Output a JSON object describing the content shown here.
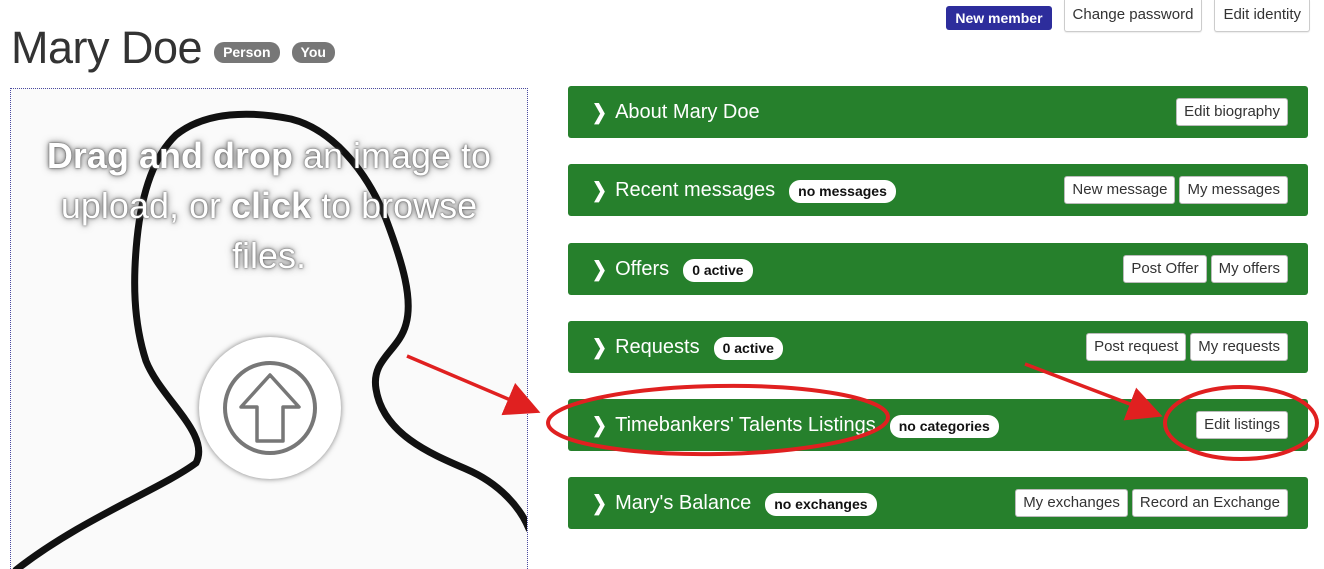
{
  "header": {
    "title": "Mary Doe",
    "badges": [
      "Person",
      "You"
    ],
    "new_member_badge": "New member",
    "change_password_label": "Change password",
    "edit_identity_label": "Edit identity"
  },
  "image_upload": {
    "drag_bold": "Drag and drop",
    "text_1": " an image to upload, or ",
    "click_bold": "click",
    "text_2": " to browse files."
  },
  "panels": [
    {
      "title": "About Mary Doe",
      "badge": "",
      "buttons": [
        "Edit biography"
      ]
    },
    {
      "title": "Recent messages",
      "badge": "no messages",
      "buttons": [
        "New message",
        "My messages"
      ]
    },
    {
      "title": "Offers",
      "badge": "0 active",
      "buttons": [
        "Post Offer",
        "My offers"
      ]
    },
    {
      "title": "Requests",
      "badge": "0 active",
      "buttons": [
        "Post request",
        "My requests"
      ]
    },
    {
      "title": "Timebankers' Talents Listings",
      "badge": "no categories",
      "buttons": [
        "Edit listings"
      ]
    },
    {
      "title": "Mary's Balance",
      "badge": "no exchanges",
      "buttons": [
        "My exchanges",
        "Record an Exchange"
      ]
    }
  ],
  "colors": {
    "panel_green": "#26802c",
    "new_member_blue": "#2d2d9c",
    "badge_grey": "#777777",
    "annotation_red": "#e02020"
  },
  "icons": [
    "chevron-right-icon",
    "upload-arrow-icon",
    "person-silhouette"
  ]
}
